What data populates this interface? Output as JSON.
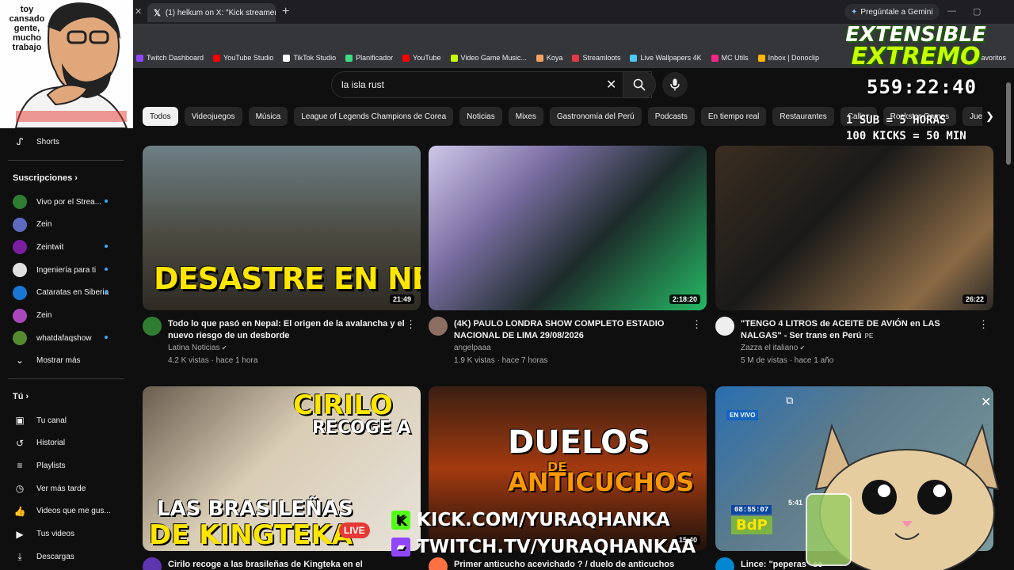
{
  "browser": {
    "tab_title": "(1) helkum on X: \"Kick streamer",
    "gemini_label": "Pregúntale a Gemini",
    "bookmarks": [
      {
        "label": "Twitch Dashboard",
        "color": "#9146ff"
      },
      {
        "label": "YouTube Studio",
        "color": "#ff0000"
      },
      {
        "label": "TikTok Studio",
        "color": "#ffffff"
      },
      {
        "label": "Planificador",
        "color": "#3ddc84"
      },
      {
        "label": "YouTube",
        "color": "#ff0000"
      },
      {
        "label": "Video Game Music...",
        "color": "#c6ff00"
      },
      {
        "label": "Koya",
        "color": "#f4a261"
      },
      {
        "label": "Streamloots",
        "color": "#e63946"
      },
      {
        "label": "Live Wallpapers 4K",
        "color": "#4cc9f0"
      },
      {
        "label": "MC Utils",
        "color": "#f72585"
      },
      {
        "label": "Inbox | Donoclip",
        "color": "#ffb703"
      }
    ],
    "favorites_label": "avoritos"
  },
  "search": {
    "query": "la isla rust"
  },
  "chips": [
    "Todos",
    "Videojuegos",
    "Música",
    "League of Legends Champions de Corea",
    "Noticias",
    "Mixes",
    "Gastronomía del Perú",
    "Podcasts",
    "En tiempo real",
    "Restaurantes",
    "Calles",
    "Rockstar Games",
    "Juego de rol"
  ],
  "sidebar": {
    "shorts": "Shorts",
    "subscriptions_title": "Suscripciones",
    "subscriptions": [
      {
        "label": "Vivo por el Strea...",
        "color": "#2e7d32",
        "live": true
      },
      {
        "label": "Zein",
        "color": "#5c6bc0",
        "live": false
      },
      {
        "label": "Zeintwit",
        "color": "#7b1fa2",
        "live": true
      },
      {
        "label": "Ingeniería para ti",
        "color": "#e0e0e0",
        "live": true
      },
      {
        "label": "Cataratas en Siberia",
        "color": "#1976d2",
        "live": true
      },
      {
        "label": "Zein",
        "color": "#ab47bc",
        "live": false
      },
      {
        "label": "whatdafaqshow",
        "color": "#558b2f",
        "live": true
      }
    ],
    "show_more": "Mostrar más",
    "you_title": "Tú",
    "you_items": [
      "Tu canal",
      "Historial",
      "Playlists",
      "Ver más tarde",
      "Videos que me gus...",
      "Tus videos",
      "Descargas"
    ]
  },
  "videos": [
    {
      "title": "Todo lo que pasó en Nepal: El origen de la avalancha y el nuevo riesgo de un desborde",
      "channel": "Latina Noticias",
      "verified": true,
      "stats": "4.2 K vistas · hace 1 hora",
      "duration": "21:49",
      "thumb_text": "DESASTRE EN NEPAL",
      "avatar": "#2e7d32"
    },
    {
      "title": "(4K) PAULO LONDRA SHOW COMPLETO ESTADIO NACIONAL DE LIMA 29/08/2026",
      "channel": "angelpaaa",
      "verified": false,
      "stats": "1.9 K vistas · hace 7 horas",
      "duration": "2:18:20",
      "thumb_text": "",
      "avatar": "#8d6e63"
    },
    {
      "title": "\"TENGO 4 LITROS de ACEITE DE AVIÓN en LAS NALGAS\" - Ser trans en Perú",
      "title_badge": "PE",
      "channel": "Zazza el italiano",
      "verified": true,
      "stats": "5 M de vistas · hace 1 año",
      "duration": "26:22",
      "thumb_text": "",
      "avatar": "#eeeeee"
    },
    {
      "title": "Cirilo recoge a las brasileñas de Kingteka en el aeropuerto,",
      "channel": "",
      "verified": false,
      "stats": "",
      "duration": "",
      "thumb_text": "CIRILO RECOGE A LAS BRASILEÑAS DE KINGTEKA",
      "thumb_l1": "CIRILO",
      "thumb_l2": "RECOGE A",
      "thumb_l3": "LAS BRASILEÑAS",
      "thumb_l4": "DE KINGTEKA",
      "live_tag": "LIVE",
      "avatar": "#5e35b1"
    },
    {
      "title": "Primer anticucho acevichado ? / duelo de anticuchos",
      "channel": "",
      "verified": false,
      "stats": "",
      "duration": "15:40",
      "thumb_l1": "DUELOS",
      "thumb_l2": "DE",
      "thumb_l3": "ANTICUCHOS",
      "avatar": "#ff7043"
    },
    {
      "title": "Lince: \"peperas\" se",
      "channel": "",
      "verified": false,
      "stats": "",
      "duration": "",
      "thumb_l1": "EN VIVO",
      "thumb_clock": "08:55:07",
      "thumb_brand": "BdP",
      "thumb_time": "5:41",
      "avatar": "#0288d1"
    }
  ],
  "overlay": {
    "cam_text": "toy cansado gente, mucho trabajo",
    "title_l1": "EXTENSIBLE",
    "title_l2": "EXTREMO",
    "timer": "559:22:40",
    "rule1": "1 SUB = 5 HORAS",
    "rule2": "100 KICKS = 50 MIN",
    "kick_url": "KICK.COM/YURAQHANKA",
    "twitch_url": "TWITCH.TV/YURAQHANKAA"
  }
}
